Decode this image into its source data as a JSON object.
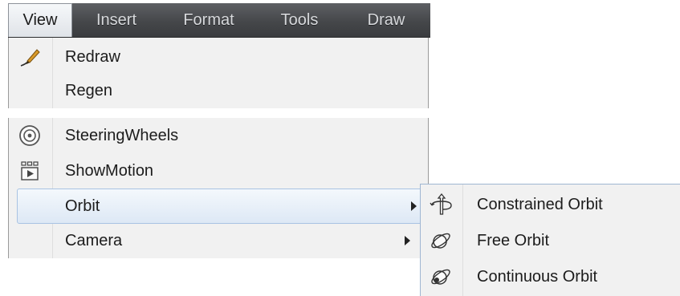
{
  "menubar": {
    "items": [
      {
        "label": "View"
      },
      {
        "label": "Insert"
      },
      {
        "label": "Format"
      },
      {
        "label": "Tools"
      },
      {
        "label": "Draw"
      }
    ]
  },
  "view_menu": {
    "items": [
      {
        "label": "Redraw",
        "icon": "redraw-pencil-icon"
      },
      {
        "label": "Regen",
        "icon": ""
      },
      {
        "label": "SteeringWheels",
        "icon": "steering-wheel-icon"
      },
      {
        "label": "ShowMotion",
        "icon": "showmotion-icon"
      },
      {
        "label": "Orbit",
        "icon": "",
        "has_submenu": true,
        "highlighted": true
      },
      {
        "label": "Camera",
        "icon": "",
        "has_submenu": true
      }
    ]
  },
  "orbit_submenu": {
    "items": [
      {
        "label": "Constrained Orbit",
        "icon": "constrained-orbit-icon"
      },
      {
        "label": "Free Orbit",
        "icon": "free-orbit-icon"
      },
      {
        "label": "Continuous Orbit",
        "icon": "continuous-orbit-icon"
      }
    ]
  },
  "colors": {
    "menubar_bg": "#45474a",
    "menu_bg": "#f1f1f1",
    "highlight_border": "#a9c3e3",
    "redraw_pencil": "#c98a1b"
  }
}
